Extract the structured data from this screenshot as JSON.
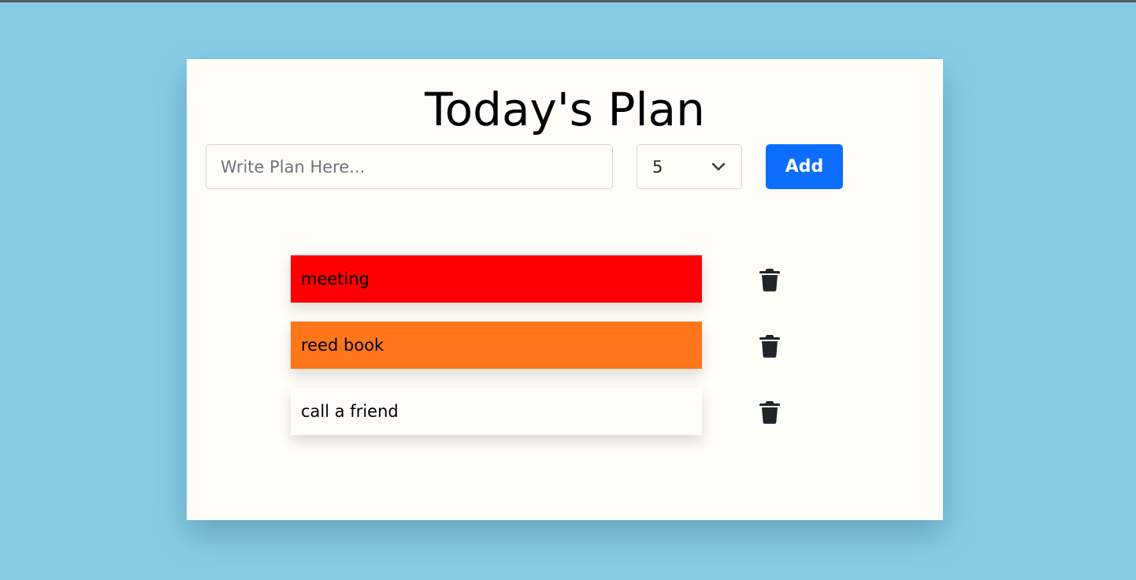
{
  "header": {
    "title": "Today's Plan"
  },
  "form": {
    "input_value": "",
    "input_placeholder": "Write Plan Here...",
    "priority_selected": "5",
    "add_label": "Add"
  },
  "plans": [
    {
      "text": "meeting",
      "color": "#ff0000"
    },
    {
      "text": "reed book",
      "color": "#ff761b"
    },
    {
      "text": "call a friend",
      "color": "#fffdf8"
    }
  ],
  "icons": {
    "dropdown": "chevron-down-icon",
    "delete": "trash-icon"
  },
  "colors": {
    "page_background": "#87cce5",
    "card_background": "#fffdf8",
    "accent": "#0d6efd"
  }
}
